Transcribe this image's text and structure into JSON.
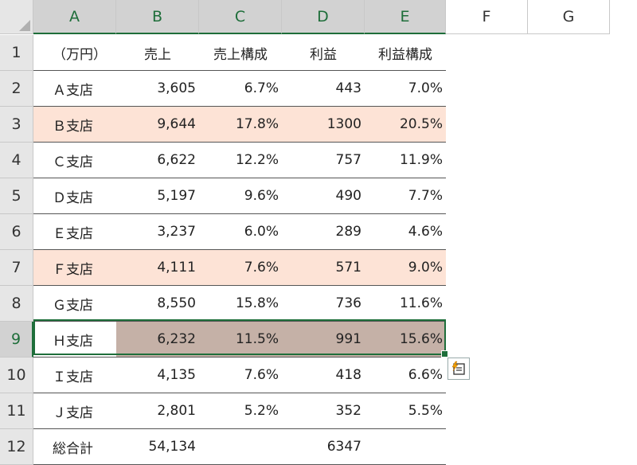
{
  "columns": [
    "A",
    "B",
    "C",
    "D",
    "E",
    "F",
    "G"
  ],
  "rows": [
    "1",
    "2",
    "3",
    "4",
    "5",
    "6",
    "7",
    "8",
    "9",
    "10",
    "11",
    "12"
  ],
  "header_row": [
    "（万円）",
    "売上",
    "売上構成",
    "利益",
    "利益構成"
  ],
  "data_rows": [
    [
      "Ａ支店",
      "3,605",
      "6.7%",
      "443",
      "7.0%"
    ],
    [
      "Ｂ支店",
      "9,644",
      "17.8%",
      "1300",
      "20.5%"
    ],
    [
      "Ｃ支店",
      "6,622",
      "12.2%",
      "757",
      "11.9%"
    ],
    [
      "Ｄ支店",
      "5,197",
      "9.6%",
      "490",
      "7.7%"
    ],
    [
      "Ｅ支店",
      "3,237",
      "6.0%",
      "289",
      "4.6%"
    ],
    [
      "Ｆ支店",
      "4,111",
      "7.6%",
      "571",
      "9.0%"
    ],
    [
      "Ｇ支店",
      "8,550",
      "15.8%",
      "736",
      "11.6%"
    ],
    [
      "Ｈ支店",
      "6,232",
      "11.5%",
      "991",
      "15.6%"
    ],
    [
      "Ｉ支店",
      "4,135",
      "7.6%",
      "418",
      "6.6%"
    ],
    [
      "Ｊ支店",
      "2,801",
      "5.2%",
      "352",
      "5.5%"
    ]
  ],
  "total_row": [
    "総合計",
    "54,134",
    "",
    "6347",
    ""
  ],
  "highlight_color": "#fde3d6",
  "selection_fill": "#c5b1a7",
  "selection_border": "#1e6e3a",
  "quick_analysis_icon": "quick-analysis-icon"
}
